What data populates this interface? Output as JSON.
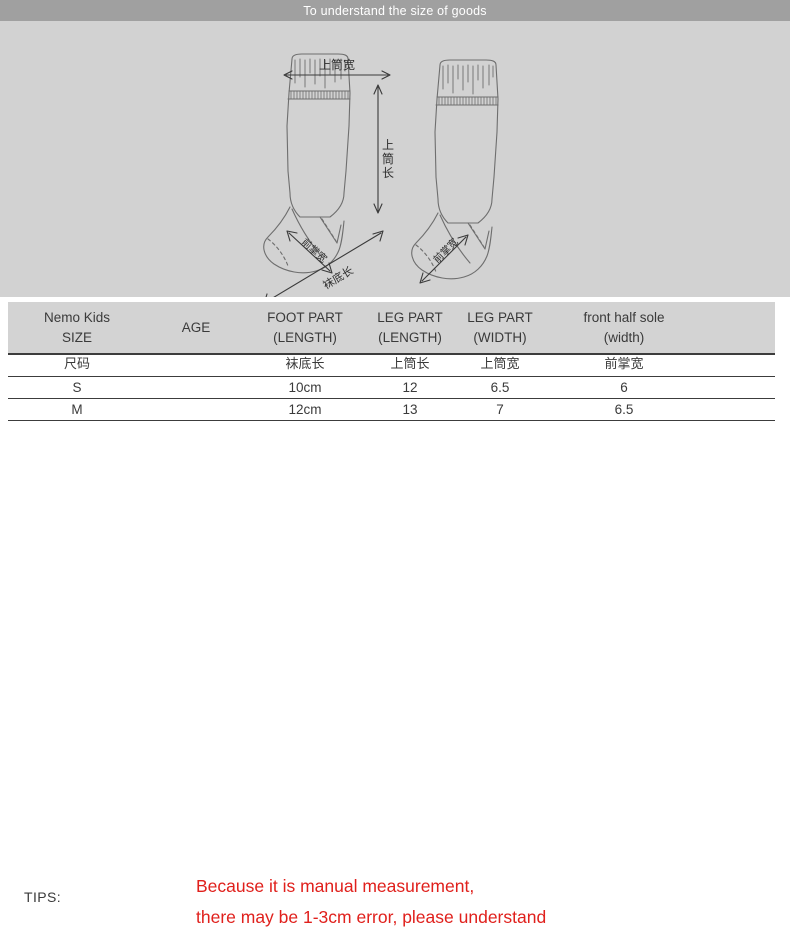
{
  "header": {
    "title": "To understand the size of goods",
    "bar_color": "#a0a0a0"
  },
  "diagram": {
    "background_color": "#d2d2d2",
    "stroke_color": "#6e6e6e",
    "label_top_width": "上筒宽",
    "label_leg_length": "上筒长",
    "label_front_sole_width_left": "前掌宽",
    "label_sole_length": "袜底长",
    "label_front_sole_width_right": "前掌宽",
    "sock_left_name": "sock-front-view",
    "sock_right_name": "sock-side-view"
  },
  "table": {
    "header": [
      {
        "line1": "Nemo Kids",
        "line2": "SIZE"
      },
      {
        "line1": "AGE",
        "line2": ""
      },
      {
        "line1": "FOOT PART",
        "line2": "(LENGTH)"
      },
      {
        "line1": "LEG PART",
        "line2": "(LENGTH)"
      },
      {
        "line1": "LEG PART",
        "line2": "(WIDTH)"
      },
      {
        "line1": "front half sole",
        "line2": "(width)"
      }
    ],
    "rows": [
      {
        "name": "chinese-label-row",
        "cells": [
          "尺码",
          "",
          "袜底长",
          "上筒长",
          "上筒宽",
          "前掌宽",
          ""
        ]
      },
      {
        "name": "size-row-s",
        "cells": [
          "S",
          "",
          "10cm",
          "12",
          "6.5",
          "6",
          ""
        ]
      },
      {
        "name": "size-row-m",
        "cells": [
          "M",
          "",
          "12cm",
          "13",
          "7",
          "6.5",
          ""
        ]
      }
    ]
  },
  "tips": {
    "label": "TIPS:",
    "line1": "Because it is manual measurement,",
    "line2": "there may be 1-3cm error, please understand",
    "color": "#e0201c"
  }
}
